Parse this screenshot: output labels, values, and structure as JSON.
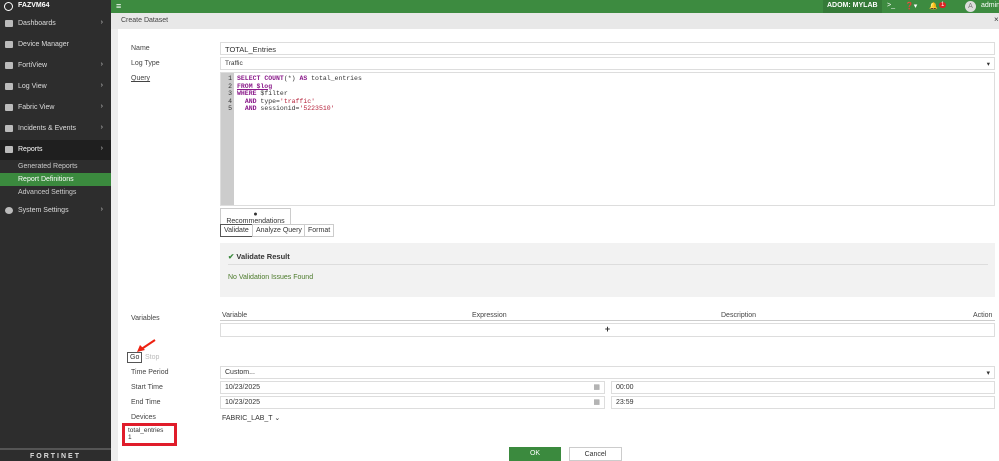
{
  "sidebar": {
    "brand": "FAZVM64",
    "items": [
      {
        "label": "Dashboards"
      },
      {
        "label": "Device Manager"
      },
      {
        "label": "FortiView"
      },
      {
        "label": "Log View"
      },
      {
        "label": "Fabric View"
      },
      {
        "label": "Incidents & Events"
      },
      {
        "label": "Reports"
      },
      {
        "label": "System Settings"
      }
    ],
    "subitems": [
      {
        "label": "Generated Reports"
      },
      {
        "label": "Report Definitions"
      },
      {
        "label": "Advanced Settings"
      }
    ],
    "footer_logo": "FORTINET"
  },
  "topbar": {
    "adom": "ADOM: MYLAB",
    "notifications": "1",
    "user": "admin",
    "avatar": "A"
  },
  "dialog": {
    "title": "Create Dataset",
    "name_label": "Name",
    "name_value": "TOTAL_Entries",
    "logtype_label": "Log Type",
    "logtype_value": "Traffic",
    "query_label": "Query",
    "query_lines": [
      "SELECT COUNT(*) AS total_entries",
      "FROM $log",
      "WHERE $filter",
      "  AND type='traffic'",
      "  AND sessionid='5223510'"
    ],
    "recommendations": "Recommendations",
    "validate": "Validate",
    "analyze": "Analyze Query",
    "format": "Format",
    "validate_title": "Validate Result",
    "validate_msg": "No Validation Issues Found",
    "variables_label": "Variables",
    "var_cols": [
      "Variable",
      "Expression",
      "Description",
      "Action"
    ],
    "add": "+",
    "go": "Go",
    "stop": "Stop",
    "time_period_label": "Time Period",
    "time_period_value": "Custom...",
    "start_label": "Start Time",
    "start_date": "10/23/2025",
    "start_time": "00:00",
    "end_label": "End Time",
    "end_date": "10/23/2025",
    "end_time": "23:59",
    "devices_label": "Devices",
    "devices_value": "FABRIC_LAB_T",
    "result_col": "total_entries",
    "result_val": "1",
    "ok": "OK",
    "cancel": "Cancel"
  }
}
